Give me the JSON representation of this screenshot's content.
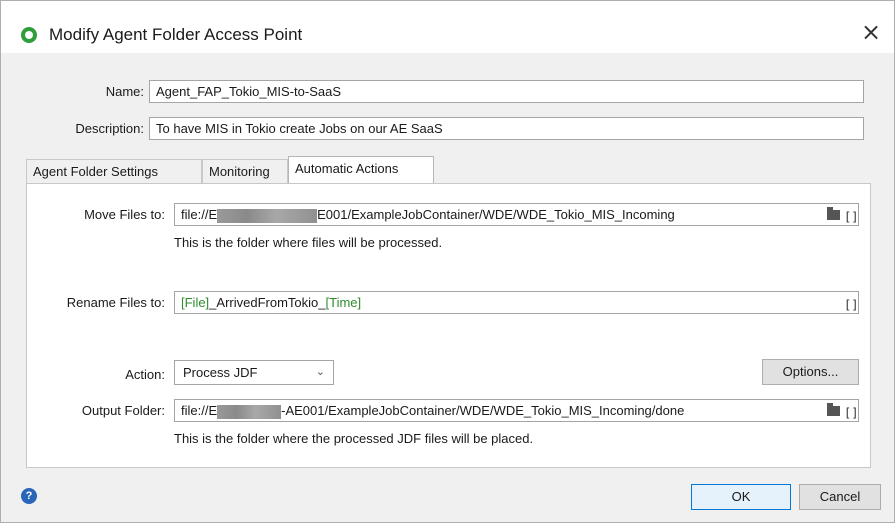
{
  "dialog": {
    "title": "Modify Agent Folder Access Point",
    "close_glyph": "×"
  },
  "general": {
    "name_label": "Name:",
    "name_value": "Agent_FAP_Tokio_MIS-to-SaaS",
    "description_label": "Description:",
    "description_value": "To have MIS in Tokio create Jobs on our AE SaaS"
  },
  "tabs": [
    {
      "label": "Agent Folder Settings",
      "active": false
    },
    {
      "label": "Monitoring",
      "active": false
    },
    {
      "label": "Automatic Actions",
      "active": true
    }
  ],
  "automatic_actions": {
    "move_files_label": "Move Files to:",
    "move_files_prefix": "file://E",
    "move_files_suffix": "E001/ExampleJobContainer/WDE/WDE_Tokio_MIS_Incoming",
    "move_files_hint": "This is the folder where files will be processed.",
    "rename_files_label": "Rename Files to:",
    "rename_token_file": "[File]",
    "rename_middle": "_ArrivedFromTokio_",
    "rename_token_time": "[Time]",
    "action_label": "Action:",
    "action_value": "Process JDF",
    "options_button": "Options...",
    "output_folder_label": "Output Folder:",
    "output_folder_prefix": "file://E",
    "output_folder_suffix": "-AE001/ExampleJobContainer/WDE/WDE_Tokio_MIS_Incoming/done",
    "output_folder_hint": "This is the folder where the processed JDF files will be placed.",
    "brackets_glyph": "[]"
  },
  "footer": {
    "help_glyph": "?",
    "ok_button": "OK",
    "cancel_button": "Cancel"
  },
  "icons": {
    "title": "agent-folder-icon",
    "close": "close-icon",
    "folder": "folder-icon",
    "brackets": "variable-brackets-icon",
    "help": "help-icon",
    "dropdown": "chevron-down-icon"
  },
  "colors": {
    "accent": "#0078d7",
    "token_green": "#2e8b2e",
    "title_icon_green": "#2e9e3a"
  }
}
